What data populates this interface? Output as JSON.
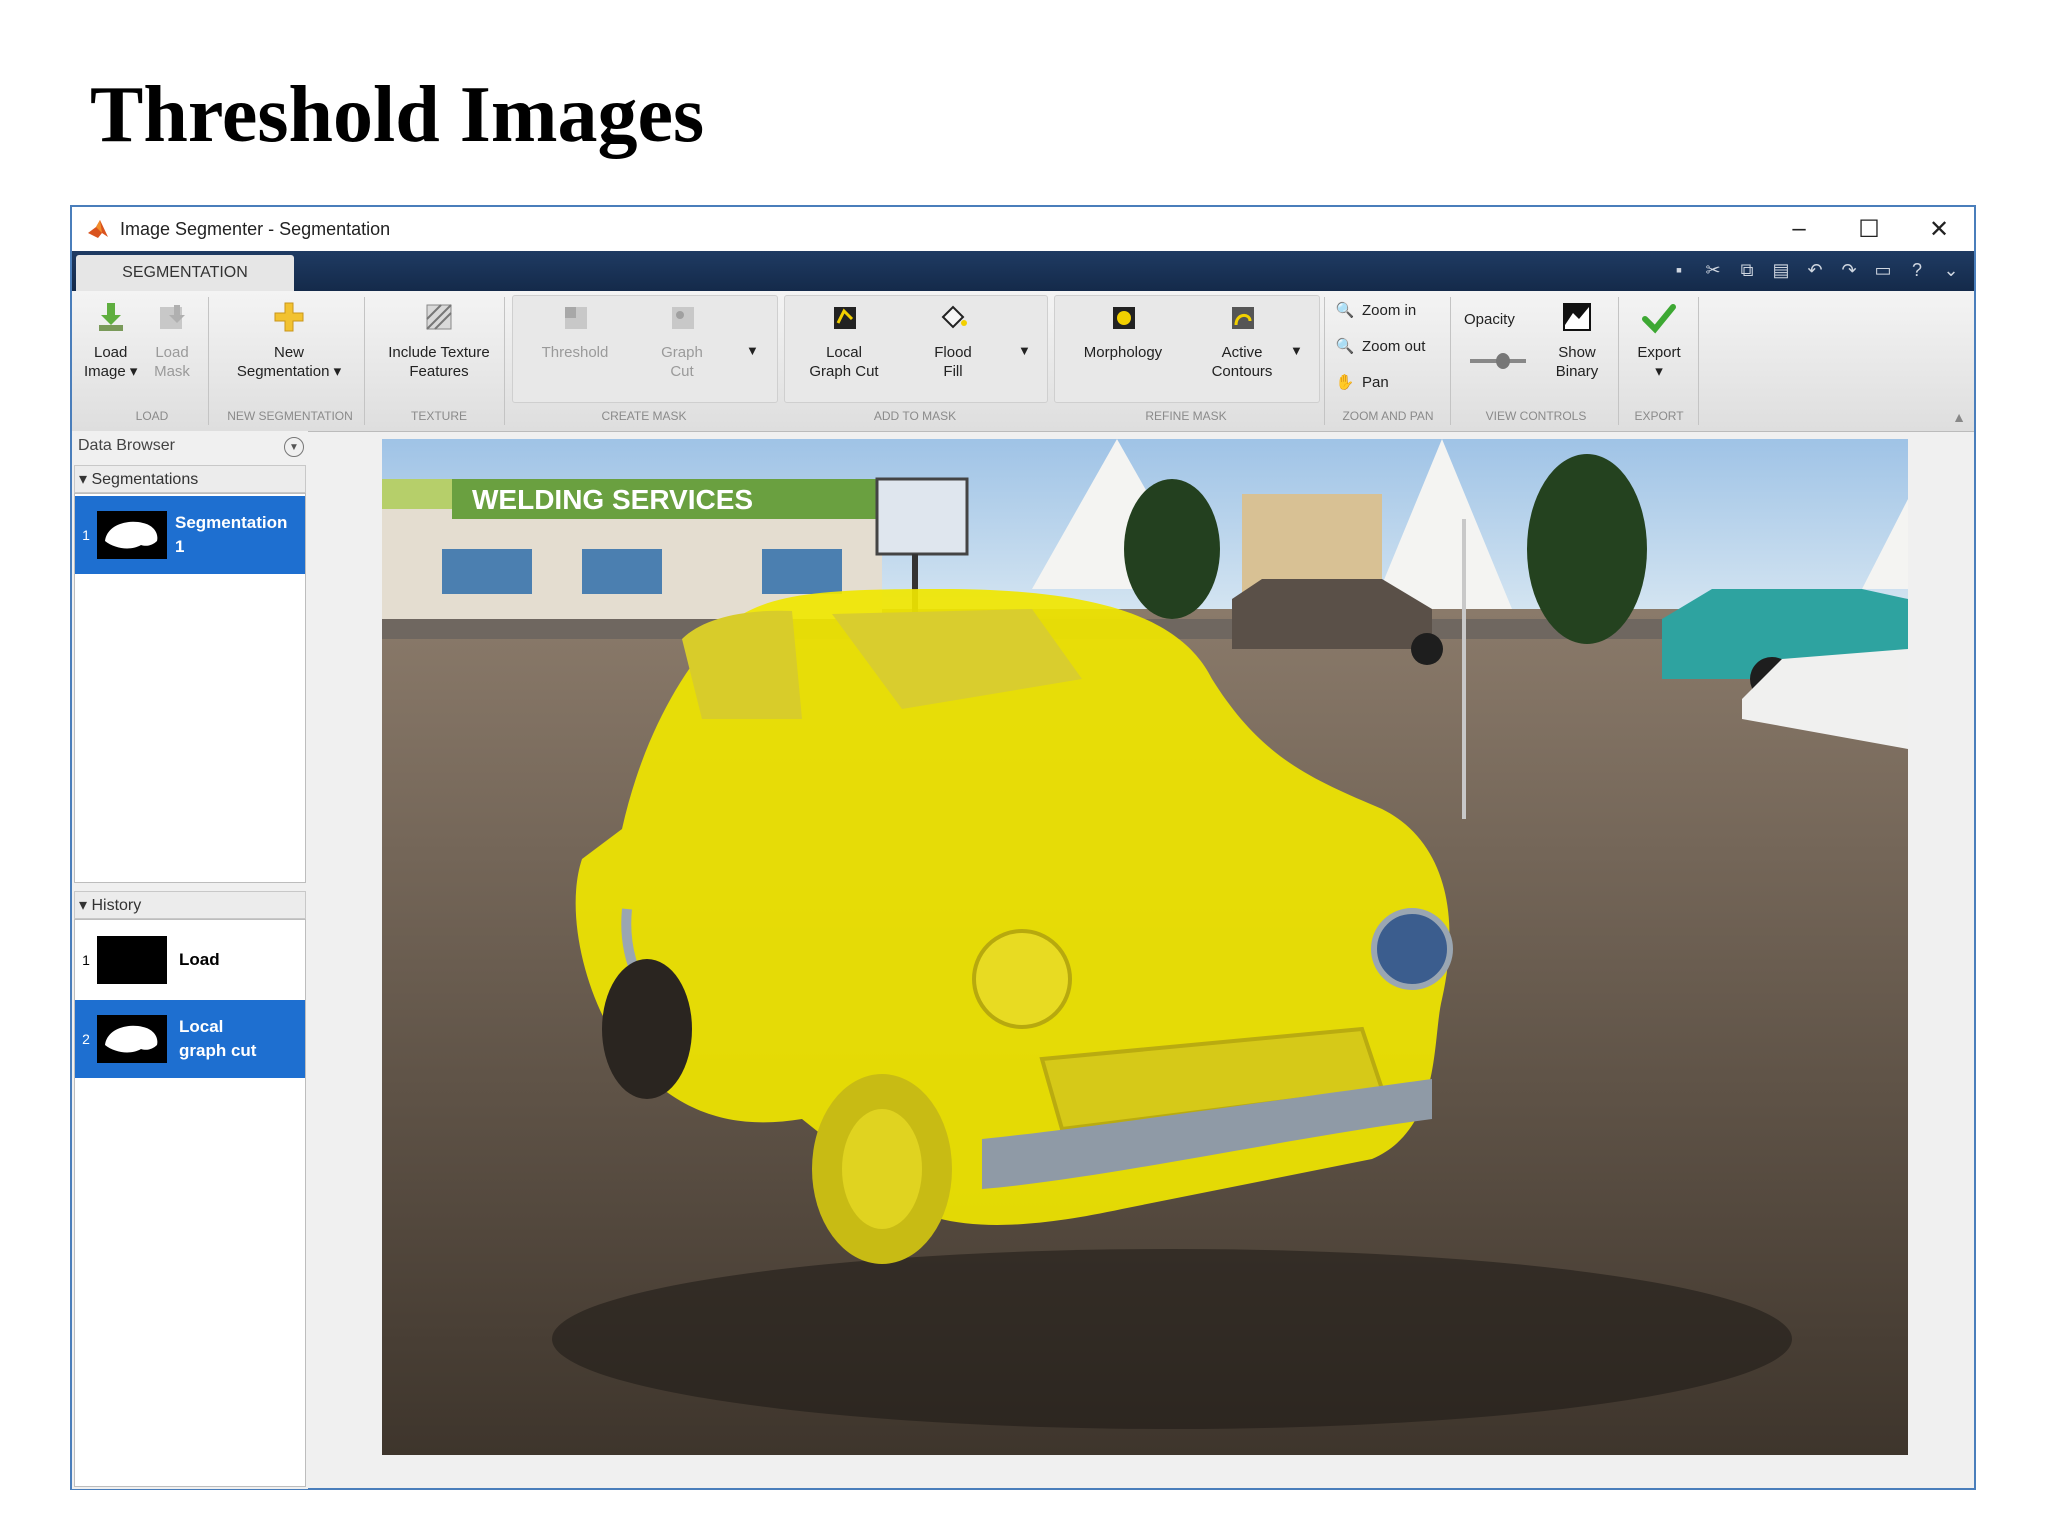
{
  "slide": {
    "title": "Threshold Images"
  },
  "window": {
    "title": "Image Segmenter - Segmentation",
    "minimize": "–",
    "maximize": "☐",
    "close": "✕"
  },
  "tabs": {
    "active": "SEGMENTATION"
  },
  "ribbon": {
    "load_image": [
      "Load",
      "Image ▾"
    ],
    "load_mask": [
      "Load",
      "Mask"
    ],
    "new_segmentation": [
      "New",
      "Segmentation ▾"
    ],
    "include_texture": [
      "Include Texture",
      "Features"
    ],
    "threshold": "Threshold",
    "graph_cut": [
      "Graph",
      "Cut"
    ],
    "local_graph_cut": [
      "Local",
      "Graph Cut"
    ],
    "flood_fill": [
      "Flood",
      "Fill"
    ],
    "morphology": "Morphology",
    "active_contours": [
      "Active",
      "Contours"
    ],
    "zoom_in": "Zoom in",
    "zoom_out": "Zoom out",
    "pan": "Pan",
    "opacity": "Opacity",
    "show_binary": [
      "Show",
      "Binary"
    ],
    "export": "Export",
    "groups": {
      "load": "LOAD",
      "new_segmentation": "NEW SEGMENTATION",
      "texture": "TEXTURE",
      "create_mask": "CREATE MASK",
      "add_to_mask": "ADD TO MASK",
      "refine_mask": "REFINE MASK",
      "zoom_and_pan": "ZOOM AND PAN",
      "view_controls": "VIEW CONTROLS",
      "export": "EXPORT"
    }
  },
  "data_browser": {
    "title": "Data Browser",
    "segmentations_header": "▾ Segmentations",
    "segmentations": [
      {
        "num": "1",
        "label": "Segmentation",
        "label2": "1"
      }
    ],
    "history_header": "▾ History",
    "history": [
      {
        "num": "1",
        "label": "Load",
        "label2": ""
      },
      {
        "num": "2",
        "label": "Local",
        "label2": "graph cut"
      }
    ]
  },
  "canvas": {
    "sign_text": "WELDING SERVICES",
    "overlay_color": "#f0e600"
  },
  "colors": {
    "accent": "#1e6fd0",
    "tabstrip": "#1f3b63",
    "window_border": "#4a7ebb"
  }
}
